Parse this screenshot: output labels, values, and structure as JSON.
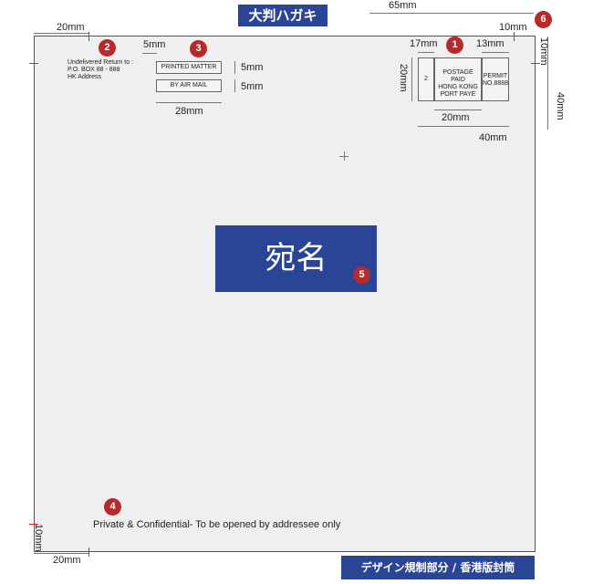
{
  "header": {
    "title": "大判ハガキ"
  },
  "footer": {
    "label": "デザイン規制部分 / 香港版封筒"
  },
  "card": {
    "return_address": [
      "Undelivered Return to :",
      "P.O. BOX  88 - 888",
      "HK Address"
    ],
    "printed_matter": "PRINTED MATTER",
    "by_air_mail": "BY AIR MAIL",
    "confidential": "Private & Confidential- To be opened by addressee only",
    "addressee": "宛名"
  },
  "postage": {
    "left_box": "2",
    "center_lines": [
      "POSTAGE PAID",
      "HONG KONG",
      "PORT PAYE"
    ],
    "permit_lines": [
      "PERMIT",
      "NO.8888"
    ]
  },
  "dimensions": {
    "top_left_margin": "20mm",
    "left_margin_top": "10mm",
    "label_gap": "5mm",
    "label_width": "28mm",
    "label_height_1": "5mm",
    "label_height_2": "5mm",
    "stamp_left": "17mm",
    "stamp_right": "13mm",
    "stamp_height": "20mm",
    "stamp_center_width": "20mm",
    "stamp_total_width": "40mm",
    "stamp_total_height": "40mm",
    "top_right_width": "65mm",
    "top_right_margin": "10mm",
    "right_margin_top": "10mm",
    "bottom_left_margin": "10mm",
    "bottom_margin": "20mm"
  },
  "markers": [
    "1",
    "2",
    "3",
    "4",
    "5",
    "6"
  ],
  "colors": {
    "accent_blue": "#2b4596",
    "marker_red": "#b52a2a",
    "card_bg": "#efefef"
  }
}
